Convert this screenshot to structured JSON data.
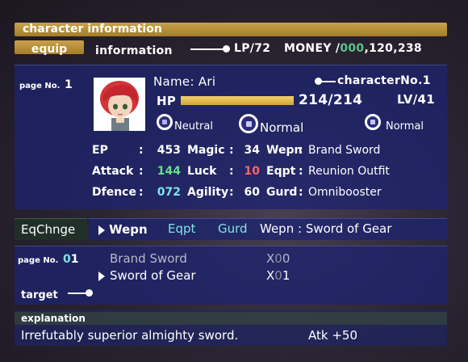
{
  "header": {
    "title": "character information",
    "tab": "equip",
    "info_label": "information",
    "lp": "LP/72",
    "money_label": "MONEY /",
    "money_zeros": "000",
    "money_value": ",120,238"
  },
  "character": {
    "page_label": "page No.",
    "page_num": "1",
    "name": "Name: Ari",
    "char_no_label": "characterNo.",
    "char_no": "1",
    "hp_label": "HP",
    "hp_fraction": 1.0,
    "hp_value": "214/214",
    "level": "LV/41",
    "modes": [
      "Neutral",
      "Normal",
      "Normal"
    ]
  },
  "stats": {
    "rows": [
      {
        "l1": "EP",
        "v1": "453",
        "l2": "Magic",
        "v2": "34",
        "l3": "Wepn",
        "v3": "Brand Sword"
      },
      {
        "l1": "Attack",
        "v1": "144",
        "l2": "Luck",
        "v2": "10",
        "l3": "Eqpt",
        "v3": "Reunion Outfit"
      },
      {
        "l1": "Dfence",
        "v1": "072",
        "l2": "Agility",
        "v2": "60",
        "l3": "Gurd",
        "v3": "Omnibooster"
      }
    ],
    "colors": {
      "attack_value": "#66e08a",
      "luck_value": "#ff6464",
      "dfence_value": "#7fe3e6"
    }
  },
  "equip_change": {
    "label": "EqChnge",
    "tabs": [
      "Wepn",
      "Eqpt",
      "Gurd"
    ],
    "current_label": "Wepn",
    "current_value": ": Sword of Gear"
  },
  "list": {
    "page_label": "page No.",
    "page_zero": "0",
    "page_num": "1",
    "target_label": "target",
    "items": [
      {
        "name": "Brand Sword",
        "qty_x": "X",
        "qty_zero": "0",
        "qty": "0"
      },
      {
        "name": "Sword of Gear",
        "qty_x": "X",
        "qty_zero": "0",
        "qty": "1"
      }
    ]
  },
  "explanation": {
    "label": "explanation",
    "text": "Irrefutably superior almighty sword.",
    "bonus": "Atk +50"
  }
}
